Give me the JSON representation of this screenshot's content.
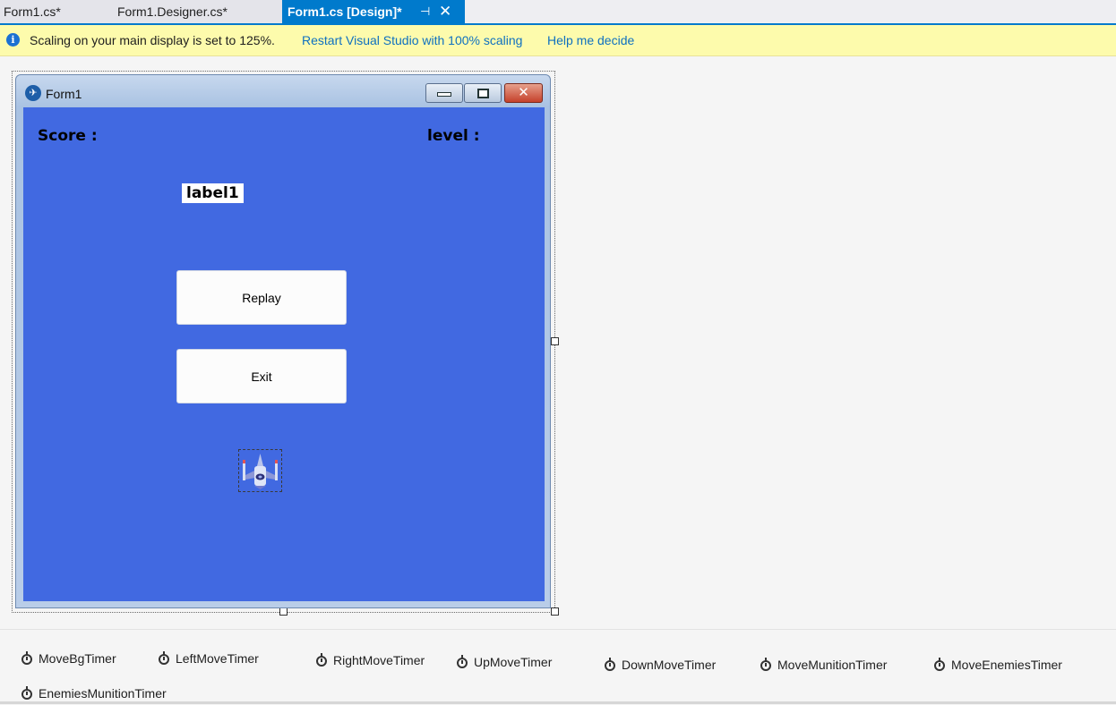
{
  "tabs": [
    {
      "label": "Form1.cs*",
      "active": false
    },
    {
      "label": "Form1.Designer.cs*",
      "active": false
    },
    {
      "label": "Form1.cs [Design]*",
      "active": true,
      "pin_icon": "pin-icon",
      "close_icon": "close-icon"
    }
  ],
  "infobar": {
    "icon": "info-icon",
    "message": "Scaling on your main display is set to 125%.",
    "link_restart": "Restart Visual Studio with 100% scaling",
    "link_help": "Help me decide"
  },
  "form": {
    "title": "Form1",
    "title_icon": "form-app-icon",
    "background_color": "#4169e1",
    "score_label": "Score :",
    "level_label": "level :",
    "label1": "label1",
    "replay_button": "Replay",
    "exit_button": "Exit",
    "ship_picture": "spaceship-image"
  },
  "tray": {
    "timers": [
      "MoveBgTimer",
      "LeftMoveTimer",
      "RightMoveTimer",
      "UpMoveTimer",
      "DownMoveTimer",
      "MoveMunitionTimer",
      "MoveEnemiesTimer",
      "EnemiesMunitionTimer"
    ]
  }
}
